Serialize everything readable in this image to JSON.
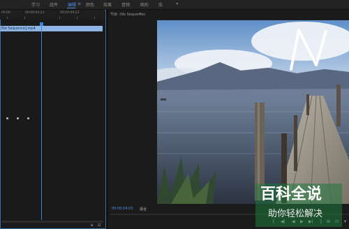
{
  "topbar": {
    "tabs": [
      {
        "label": "学习",
        "active": false
      },
      {
        "label": "组件",
        "active": false
      },
      {
        "label": "编辑",
        "active": true
      },
      {
        "label": "颜色",
        "active": false
      },
      {
        "label": "效果",
        "active": false
      },
      {
        "label": "音频",
        "active": false
      },
      {
        "label": "图形",
        "active": false
      },
      {
        "label": "库",
        "active": false
      }
    ],
    "menu_glyph": "≡",
    "more_glyph": "»"
  },
  "timeline": {
    "ruler_labels": [
      "00:00",
      "00:00:04:23",
      "00:00:09:23"
    ],
    "clip_label": "[No Sequence].mp4",
    "dots": [
      "•",
      "•",
      "•"
    ],
    "bottom_icons": [
      "⇲",
      "⊡"
    ]
  },
  "program": {
    "tab_label": "节目: (No Sequence)",
    "close_glyph": "≡",
    "timecode": "00:00:04:03",
    "fit_label": "适合",
    "transport": [
      "{",
      "◀|",
      "◀",
      "▶",
      "▶|",
      "}",
      "⊞",
      "⊡",
      "+"
    ]
  },
  "watermark": {
    "title": "百科全说",
    "subtitle": "助你轻松解决"
  },
  "colors": {
    "accent": "#4f8ee6",
    "clip": "#8eb4e6",
    "watermark_green": "#1f783e"
  }
}
